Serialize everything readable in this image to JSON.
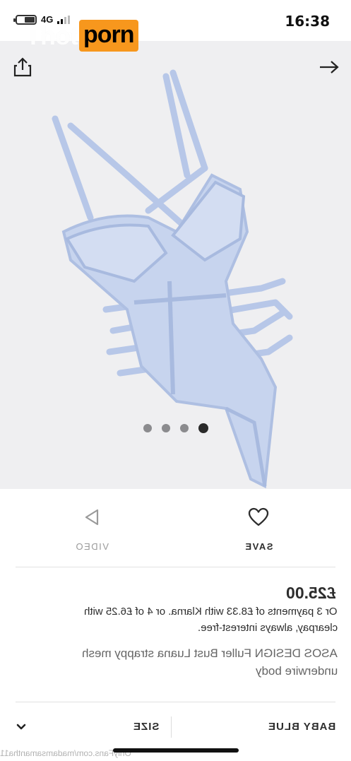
{
  "status_bar": {
    "time": "16:38",
    "network": "4G"
  },
  "watermark": {
    "part1": "Thot",
    "part2": "porn",
    "footer": "OnlyFans.com/madamsamantha11",
    "accent_color": "#f7971d"
  },
  "hero": {
    "share_icon": "share-icon",
    "next_icon": "arrow-right-icon",
    "dots_count": 4,
    "active_dot": 4
  },
  "actions": {
    "video_label": "VIDEO",
    "save_label": "SAVE",
    "video_icon": "play-triangle-icon",
    "save_icon": "heart-icon"
  },
  "product": {
    "price": "£25.00",
    "installments_line1": "Or 3 payments of £8.33 with Klarna. or 4 of £6.25 with",
    "installments_line2": "clearpay, always interest-free.",
    "title_line1": "ASOS DESIGN Fuller Bust Luana strappy mesh",
    "title_line2": "underwire body"
  },
  "selectors": {
    "colour": "BABY BLUE",
    "size": "SIZE"
  }
}
